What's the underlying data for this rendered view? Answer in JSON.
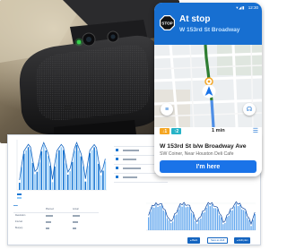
{
  "status": {
    "time": "12:30",
    "icons": "▾◢▮"
  },
  "stop": {
    "sign": "STOP",
    "title": "At stop",
    "subtitle": "W 153rd St Broadway"
  },
  "route": {
    "badge_a": "↓1",
    "badge_b": "↑2",
    "eta": "1 min"
  },
  "next_stop": {
    "name": "W 153rd St b/w Broadway Ave",
    "near": "SW Coiner, Near Houston Deli Cafe"
  },
  "action": {
    "label": "I'm here"
  },
  "dashboard": {
    "bottom_buttons": [
      "● Back",
      "Save as draft",
      "● Edit plan"
    ],
    "stats": [
      "Resolution",
      "Interval",
      "Bus(es)"
    ],
    "stat_heads": [
      "Planned",
      "Actual"
    ]
  },
  "colors": {
    "brand_blue": "#176fd1",
    "route_orange": "#f5a623",
    "route_teal": "#27b3c7"
  },
  "icons": [
    "stop-sign-icon",
    "menu-icon",
    "headset-icon",
    "navigation-arrow-icon",
    "list-icon"
  ]
}
